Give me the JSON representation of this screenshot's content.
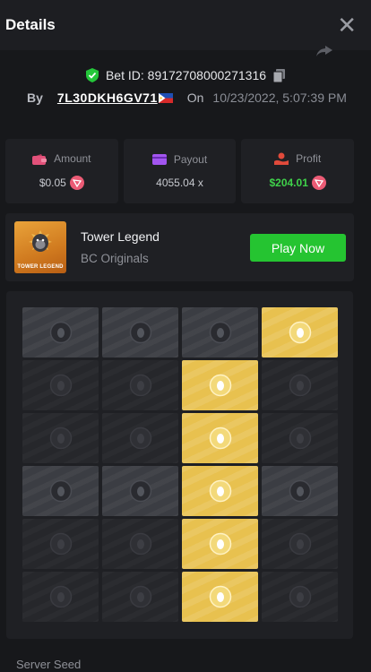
{
  "header": {
    "title": "Details"
  },
  "bet": {
    "bet_id_label": "Bet ID:",
    "bet_id": "89172708000271316",
    "by_label": "By",
    "user": "7L30DKH6GV71",
    "on_label": "On",
    "date": "10/23/2022, 5:07:39 PM"
  },
  "stats": [
    {
      "label": "Amount",
      "value": "$0.05",
      "icon": "wallet-icon",
      "color": "#e2517a"
    },
    {
      "label": "Payout",
      "value": "4055.04 x",
      "icon": "card-icon",
      "color": "#a255f0"
    },
    {
      "label": "Profit",
      "value": "$204.01",
      "icon": "profit-icon",
      "color": "#e04a3b"
    }
  ],
  "game": {
    "thumb_text": "TOWER LEGEND",
    "name": "Tower Legend",
    "provider": "BC Originals",
    "play_label": "Play Now"
  },
  "board": {
    "columns": 4,
    "rows": [
      [
        "revealed",
        "revealed",
        "revealed",
        "gold"
      ],
      [
        "hidden",
        "hidden",
        "gold",
        "hidden"
      ],
      [
        "hidden",
        "hidden",
        "gold",
        "hidden"
      ],
      [
        "revealed",
        "revealed",
        "gold",
        "revealed"
      ],
      [
        "hidden",
        "hidden",
        "gold",
        "hidden"
      ],
      [
        "hidden",
        "hidden",
        "gold",
        "hidden"
      ]
    ]
  },
  "server_seed_label": "Server Seed",
  "colors": {
    "accent_green": "#25c431",
    "gold": "#e8c14f",
    "profit_green": "#3fd14a"
  }
}
